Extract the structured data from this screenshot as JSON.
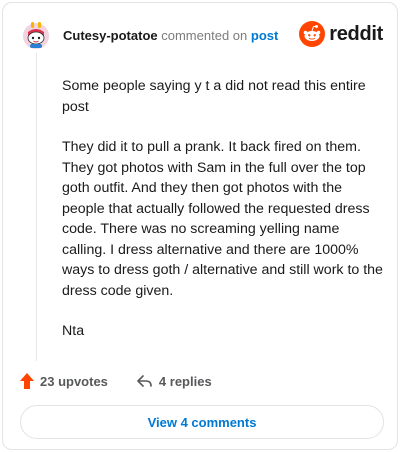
{
  "header": {
    "author": "Cutesy-potatoe",
    "action": "commented on",
    "post_link": "post",
    "brand": "reddit"
  },
  "comment": {
    "paragraphs": [
      "Some people saying y t a did not read this entire post",
      "They did it to pull a prank. It back fired on them. They got photos with Sam in the full over the top goth outfit. And they then got photos with the people that actually followed the requested dress code. There was no screaming yelling name calling. I dress alternative and there are 1000% ways to dress goth / alternative and still work to the dress code given.",
      "Nta"
    ]
  },
  "stats": {
    "upvotes": "23 upvotes",
    "replies": "4 replies"
  },
  "view_comments_label": "View 4 comments",
  "icons": {
    "avatar": "snoo-avatar-icon",
    "brand": "reddit-snoo-icon",
    "upvote": "upvote-arrow-icon",
    "reply": "reply-arrow-icon"
  },
  "colors": {
    "brand_orange": "#ff4500",
    "link_blue": "#0079d3",
    "upvote": "#ff4500"
  }
}
